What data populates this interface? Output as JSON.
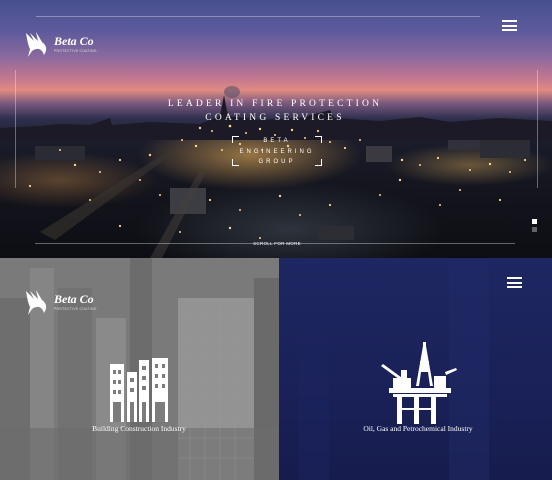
{
  "brand": {
    "name": "Beta Co",
    "tagline": "PROTECTIVE COATING"
  },
  "hero": {
    "headline_line1": "LEADER IN FIRE PROTECTION",
    "headline_line2": "COATING SERVICES",
    "group_line1": "BETA",
    "group_line2": "ENGINEERING",
    "group_line3": "GROUP",
    "scroll_label": "SCROLL FOR MORE",
    "slides": [
      {
        "active": true
      },
      {
        "active": false
      }
    ]
  },
  "industries": [
    {
      "label": "Building Construction Industry",
      "icon": "building-icon"
    },
    {
      "label": "Oil, Gas and Petrochemical Industry",
      "icon": "oil-rig-icon"
    }
  ],
  "colors": {
    "panel_left": "#7c7c7c",
    "panel_right": "#1e2762",
    "text": "#ffffff"
  }
}
